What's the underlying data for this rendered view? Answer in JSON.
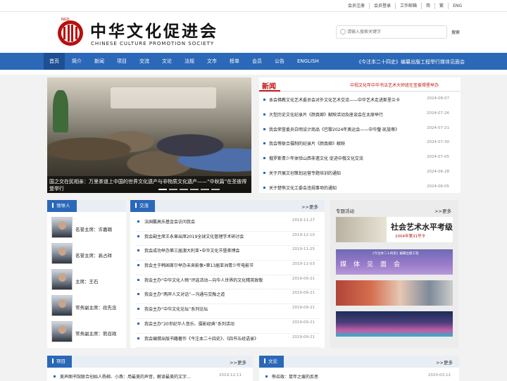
{
  "topbar": {
    "links": [
      "会员注册",
      "会员登录",
      "工作邮箱",
      "简",
      "繁",
      "ENG"
    ]
  },
  "header": {
    "logo_cn": "中华文化促进会",
    "logo_en": "CHINESE CULTURE PROMOTION SOCIETY",
    "logo_ngo": "NGO",
    "search_placeholder": "请输入搜索关键字",
    "search_button": "搜索"
  },
  "nav": {
    "items": [
      "首页",
      "简介",
      "新闻",
      "项目",
      "交流",
      "文论",
      "法规",
      "文市",
      "榜单",
      "会员",
      "公告",
      "ENGLISH"
    ],
    "active_index": 0,
    "notice": "《今注本二十四史》编纂出版工程举行媒体见面会"
  },
  "marquee": "中视文化年中华书法艺术大师班在圣彼得堡举办",
  "hero": {
    "caption": "国之交在民相亲：万里茶道上中国的世界文化遗产与非物质文化遗产——“中秋篇”在圣彼得堡举行",
    "slide_count": 6,
    "active_slide": 0
  },
  "news": {
    "tab": "新闻",
    "items": [
      {
        "title": "本会佛教文化艺术委员会对外文化艺术交流——中华艺术走进斯里兰卡",
        "date": "2024-08-07"
      },
      {
        "title": "大型历史文化纪录片《颜真卿》献映活动及座谈会在太原举行",
        "date": "2024-07-26"
      },
      {
        "title": "我会荣誉委员白明设计商品《巴黎2024年奥运会——中华璧·凯旋尊》",
        "date": "2024-07-21"
      },
      {
        "title": "我会等联合摄制的纪录片《颜真卿》献映",
        "date": "2024-07-30"
      },
      {
        "title": "俄罗斯青少年体验山西非遗文化 促进中俄文化交流",
        "date": "2024-07-05"
      },
      {
        "title": "关于开展文创策划运营专题培训的通知",
        "date": "2024-06-28"
      },
      {
        "title": "关于楚熊文化工委会违规事项的通知",
        "date": "2024-06-05"
      }
    ]
  },
  "leaders": {
    "tab": "领导人",
    "items": [
      {
        "name": "名誉主席：许嘉璐"
      },
      {
        "name": "名誉主席：高占祥"
      },
      {
        "name": "主席：王石"
      },
      {
        "name": "常务副主席：段先念"
      },
      {
        "name": "常务副主席：熊召政"
      }
    ]
  },
  "exchange": {
    "tab": "交流",
    "more": ">>更多",
    "items": [
      {
        "title": "法国戴高乐基金会访问我会",
        "date": "2019-11-27"
      },
      {
        "title": "我会副主席王永章出席2019全球文化管理学术研讨会",
        "date": "2019-12-10"
      },
      {
        "title": "我会成功举办第三届澳大利亚•中华文化节暨茶博会",
        "date": "2019-11-25"
      },
      {
        "title": "我会主于韩国首尔举办未来影像•第13届亚洲青少年电影节",
        "date": "2019-11-03"
      },
      {
        "title": "我会主办“中华文化人物”评选活动—向华人世界的文化精英致敬",
        "date": "2019-09-21"
      },
      {
        "title": "我会主办“两岸人文对话”—沟通与交融之道",
        "date": "2019-09-21"
      },
      {
        "title": "我会主办“中华文化论坛”系列论坛",
        "date": "2019-09-21"
      },
      {
        "title": "我会主办“20世纪华人音乐、摄影经典”系列活动",
        "date": "2019-09-21"
      },
      {
        "title": "我会编撰出版书籍著作《今注本二十四史》、《四书五经语录》",
        "date": "2019-09-21"
      }
    ]
  },
  "topics": {
    "title": "专题活动",
    "more": ">>更多",
    "banner1_big": "社会艺术水平考级",
    "banner1_small": "2004年第31号令",
    "banner2_head": "《今注本二十四史》编纂出版工程",
    "banner2_mid": "媒体见面会"
  },
  "project_block": {
    "tab": "项目",
    "more": ">>更多",
    "row_title": "美声图书馆联合创始人杨柳、小燕：用最美的声音，解读最美的文字…",
    "row_date": "2019-12-11"
  },
  "essay_block": {
    "tab": "文论",
    "more": ">>更多",
    "row_title": "熊召政：鼠年之痕的反思",
    "row_date": "2020-03-12"
  }
}
